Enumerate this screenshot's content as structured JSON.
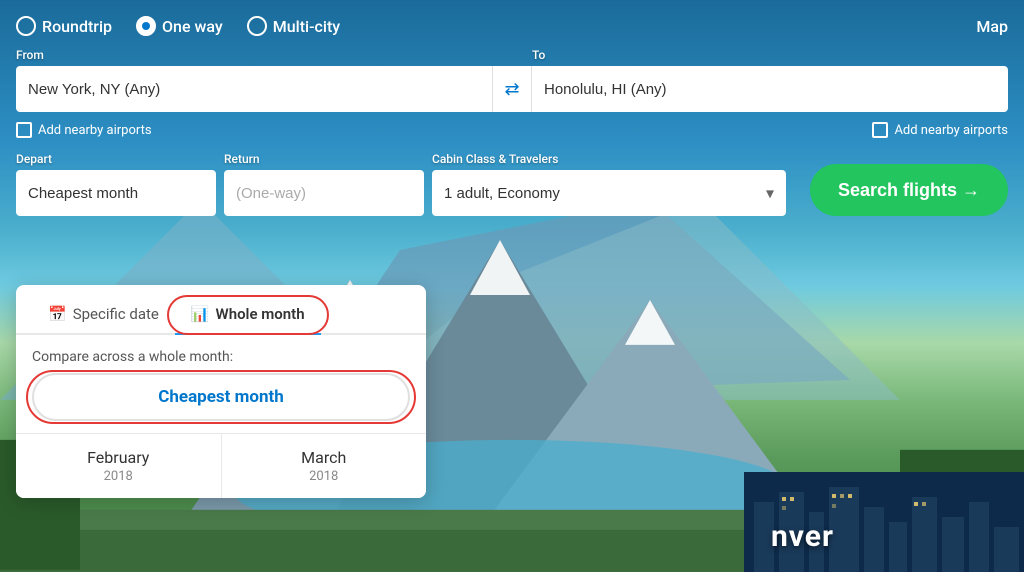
{
  "trip_types": [
    {
      "id": "roundtrip",
      "label": "Roundtrip",
      "selected": false
    },
    {
      "id": "oneway",
      "label": "One way",
      "selected": true
    },
    {
      "id": "multicity",
      "label": "Multi-city",
      "selected": false
    }
  ],
  "map_label": "Map",
  "from": {
    "label": "From",
    "value": "New York, NY (Any)",
    "placeholder": "From"
  },
  "to": {
    "label": "To",
    "value": "Honolulu, HI (Any)",
    "placeholder": "To"
  },
  "swap_icon": "⇄",
  "nearby_from": "Add nearby airports",
  "nearby_to": "Add nearby airports",
  "depart": {
    "label": "Depart",
    "value": "Cheapest month"
  },
  "return": {
    "label": "Return",
    "value": "(One-way)"
  },
  "cabin": {
    "label": "Cabin Class & Travelers",
    "value": "1 adult, Economy"
  },
  "search_btn": "Search flights →",
  "dropdown": {
    "tabs": [
      {
        "id": "specific",
        "label": "Specific date",
        "icon": "📅",
        "active": false
      },
      {
        "id": "whole-month",
        "label": "Whole month",
        "icon": "📊",
        "active": true
      }
    ],
    "compare_text": "Compare across a whole month:",
    "cheapest_btn": "Cheapest month",
    "months": [
      {
        "name": "February",
        "year": "2018"
      },
      {
        "name": "March",
        "year": "2018"
      }
    ]
  },
  "city_label": "nver"
}
